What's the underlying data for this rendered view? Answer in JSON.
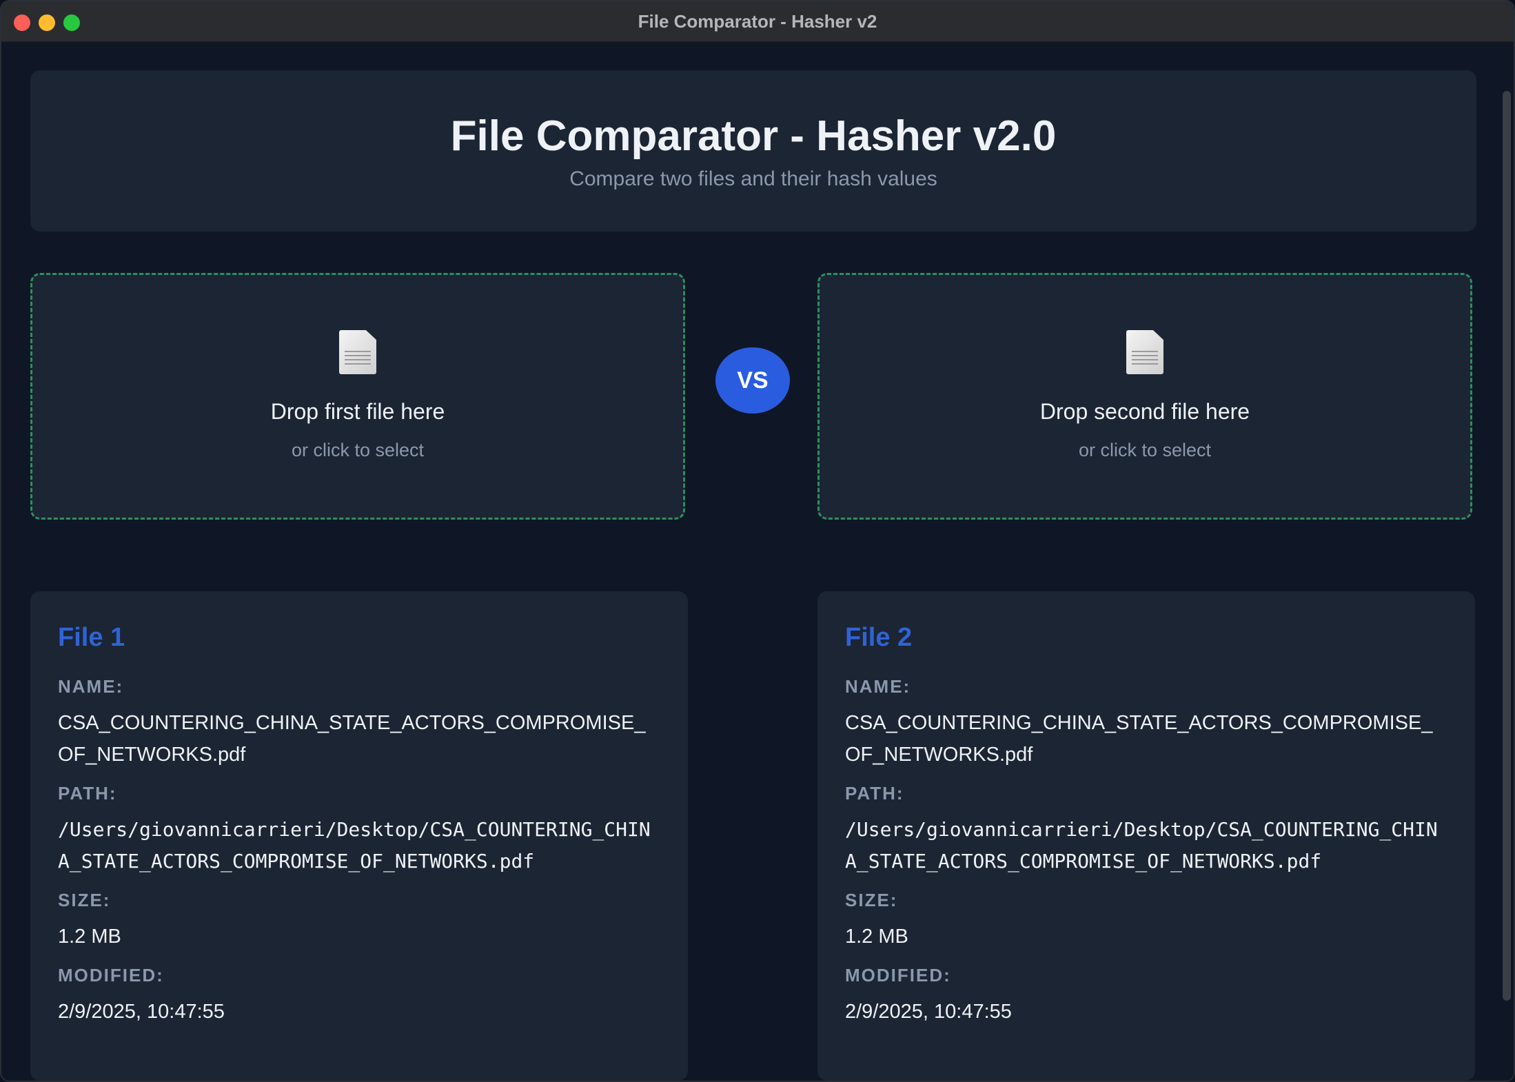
{
  "window": {
    "title": "File Comparator - Hasher v2"
  },
  "header": {
    "title": "File Comparator - Hasher v2.0",
    "subtitle": "Compare two files and their hash values"
  },
  "drop_zones": [
    {
      "title": "Drop first file here",
      "subtitle": "or click to select",
      "icon": "document-icon"
    },
    {
      "title": "Drop second file here",
      "subtitle": "or click to select",
      "icon": "document-icon"
    }
  ],
  "vs_label": "VS",
  "labels": {
    "name": "NAME:",
    "path": "PATH:",
    "size": "SIZE:",
    "modified": "MODIFIED:"
  },
  "files": [
    {
      "heading": "File 1",
      "name": "CSA_COUNTERING_CHINA_STATE_ACTORS_COMPROMISE_OF_NETWORKS.pdf",
      "path": "/Users/giovannicarrieri/Desktop/CSA_COUNTERING_CHINA_STATE_ACTORS_COMPROMISE_OF_NETWORKS.pdf",
      "size": "1.2 MB",
      "modified": "2/9/2025, 10:47:55"
    },
    {
      "heading": "File 2",
      "name": "CSA_COUNTERING_CHINA_STATE_ACTORS_COMPROMISE_OF_NETWORKS.pdf",
      "path": "/Users/giovannicarrieri/Desktop/CSA_COUNTERING_CHINA_STATE_ACTORS_COMPROMISE_OF_NETWORKS.pdf",
      "size": "1.2 MB",
      "modified": "2/9/2025, 10:47:55"
    }
  ],
  "colors": {
    "accent": "#2a5ce0",
    "heading_blue": "#2f63d6",
    "dashed_border": "#2f8f5e",
    "card_bg": "#1c2533",
    "window_bg": "#0f1726"
  }
}
